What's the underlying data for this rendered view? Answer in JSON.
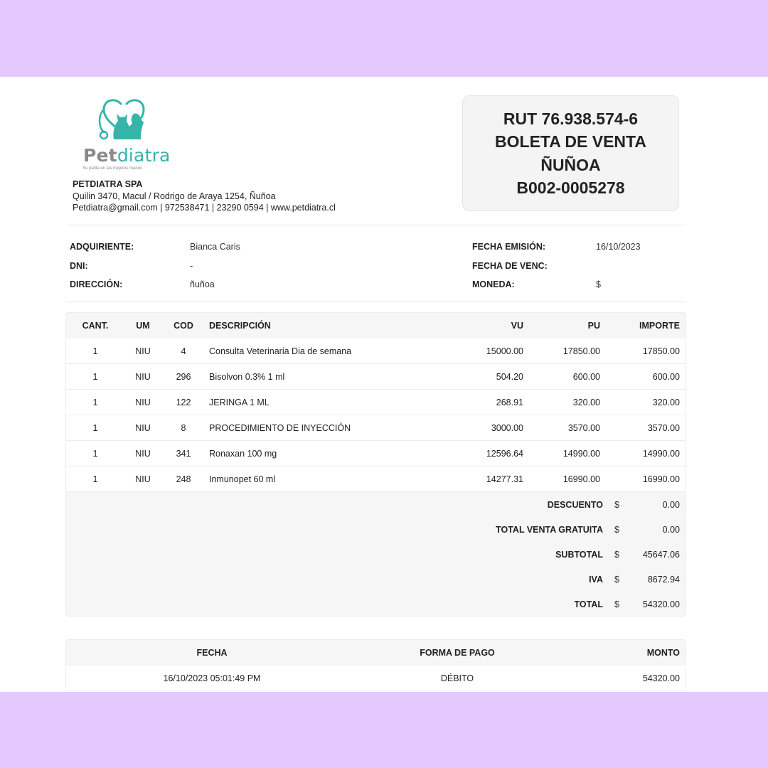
{
  "brand": {
    "name_part1": "Pet",
    "name_part2": "diatra",
    "tagline": "Su patita en las mejores manos",
    "primary_color": "#36b4aa",
    "secondary_color": "#8a8a8a",
    "logo_icon": "cat-dog-stethoscope-icon"
  },
  "company": {
    "name": "PETDIATRA SPA",
    "address": "Quilin 3470, Macul / Rodrigo de Araya 1254, Ñuñoa",
    "contact": "Petdiatra@gmail.com | 972538471 | 23290 0594 | www.petdiatra.cl"
  },
  "document": {
    "rut": "RUT 76.938.574-6",
    "type": "BOLETA DE VENTA",
    "branch": "ÑUÑOA",
    "number": "B002-0005278"
  },
  "customer": {
    "adquiriente_label": "ADQUIRIENTE:",
    "adquiriente_value": "Bianca Caris",
    "dni_label": "DNI:",
    "dni_value": "-",
    "direccion_label": "DIRECCIÓN:",
    "direccion_value": "ñuñoa",
    "fecha_emision_label": "FECHA EMISIÓN:",
    "fecha_emision_value": "16/10/2023",
    "fecha_venc_label": "FECHA DE VENC:",
    "fecha_venc_value": "",
    "moneda_label": "MONEDA:",
    "moneda_value": "$"
  },
  "items_table": {
    "headers": {
      "cant": "CANT.",
      "um": "UM",
      "cod": "COD",
      "desc": "DESCRIPCIÓN",
      "vu": "VU",
      "pu": "PU",
      "importe": "IMPORTE"
    },
    "rows": [
      {
        "cant": "1",
        "um": "NIU",
        "cod": "4",
        "desc": "Consulta Veterinaria Dia de semana",
        "vu": "15000.00",
        "pu": "17850.00",
        "importe": "17850.00"
      },
      {
        "cant": "1",
        "um": "NIU",
        "cod": "296",
        "desc": "Bisolvon 0.3% 1 ml",
        "vu": "504.20",
        "pu": "600.00",
        "importe": "600.00"
      },
      {
        "cant": "1",
        "um": "NIU",
        "cod": "122",
        "desc": "JERINGA 1 ML",
        "vu": "268.91",
        "pu": "320.00",
        "importe": "320.00"
      },
      {
        "cant": "1",
        "um": "NIU",
        "cod": "8",
        "desc": "PROCEDIMIENTO DE INYECCIÓN",
        "vu": "3000.00",
        "pu": "3570.00",
        "importe": "3570.00"
      },
      {
        "cant": "1",
        "um": "NIU",
        "cod": "341",
        "desc": "Ronaxan 100 mg",
        "vu": "12596.64",
        "pu": "14990.00",
        "importe": "14990.00"
      },
      {
        "cant": "1",
        "um": "NIU",
        "cod": "248",
        "desc": "Inmunopet 60 ml",
        "vu": "14277.31",
        "pu": "16990.00",
        "importe": "16990.00"
      }
    ]
  },
  "totals": [
    {
      "label": "DESCUENTO",
      "currency": "$",
      "value": "0.00"
    },
    {
      "label": "TOTAL VENTA GRATUITA",
      "currency": "$",
      "value": "0.00"
    },
    {
      "label": "SUBTOTAL",
      "currency": "$",
      "value": "45647.06"
    },
    {
      "label": "IVA",
      "currency": "$",
      "value": "8672.94"
    },
    {
      "label": "TOTAL",
      "currency": "$",
      "value": "54320.00"
    }
  ],
  "payments": {
    "headers": {
      "fecha": "FECHA",
      "forma": "FORMA DE PAGO",
      "monto": "MONTO"
    },
    "rows": [
      {
        "fecha": "16/10/2023 05:01:49 PM",
        "forma": "DÉBITO",
        "monto": "54320.00"
      }
    ]
  },
  "colors": {
    "frame_background": "#e3c9fd",
    "paper": "#ffffff",
    "header_fill": "#f6f6f6"
  }
}
